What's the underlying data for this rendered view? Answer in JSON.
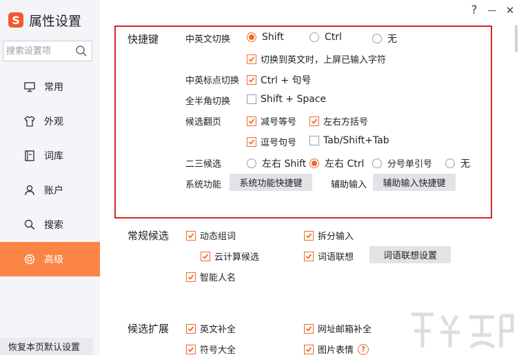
{
  "app": {
    "logo_letter": "S",
    "title": "属性设置"
  },
  "window": {
    "help": "?",
    "minimize": "—",
    "close": "✕"
  },
  "search": {
    "placeholder": "搜索设置项"
  },
  "sidebar": {
    "items": [
      {
        "label": "常用",
        "icon": "monitor-icon"
      },
      {
        "label": "外观",
        "icon": "shirt-icon"
      },
      {
        "label": "词库",
        "icon": "book-icon"
      },
      {
        "label": "账户",
        "icon": "user-icon"
      },
      {
        "label": "搜索",
        "icon": "search-icon"
      },
      {
        "label": "高级",
        "icon": "gear-icon",
        "active": true
      }
    ],
    "reset_label": "恢复本页默认设置"
  },
  "shortcuts": {
    "title": "快捷键",
    "cn_en_switch": {
      "label": "中英文切换",
      "options": [
        "Shift",
        "Ctrl",
        "无"
      ],
      "selected": "Shift",
      "commit_option": "切换到英文时，上屏已输入字符"
    },
    "punct_switch": {
      "label": "中英标点切换",
      "option": "Ctrl + 句号"
    },
    "width_switch": {
      "label": "全半角切换",
      "option": "Shift + Space"
    },
    "page_turn": {
      "label": "候选翻页",
      "options": [
        "减号等号",
        "左右方括号",
        "逗号句号",
        "Tab/Shift+Tab"
      ]
    },
    "second_third": {
      "label": "二三候选",
      "options": [
        "左右 Shift",
        "左右 Ctrl",
        "分号单引号",
        "无"
      ],
      "selected": "左右 Ctrl"
    },
    "system": {
      "label": "系统功能",
      "button": "系统功能快捷键"
    },
    "assist": {
      "label": "辅助输入",
      "button": "辅助输入快捷键"
    }
  },
  "general_candidates": {
    "title": "常规候选",
    "options": [
      "动态组词",
      "拆分输入",
      "云计算候选",
      "词语联想",
      "智能人名"
    ],
    "assoc_button": "词语联想设置"
  },
  "candidate_ext": {
    "title": "候选扩展",
    "options": [
      "英文补全",
      "网址邮箱补全",
      "符号大全",
      "图片表情"
    ]
  },
  "colors": {
    "accent": "#fc8445",
    "highlight_border": "#d72626",
    "check": "#f06a2b"
  }
}
